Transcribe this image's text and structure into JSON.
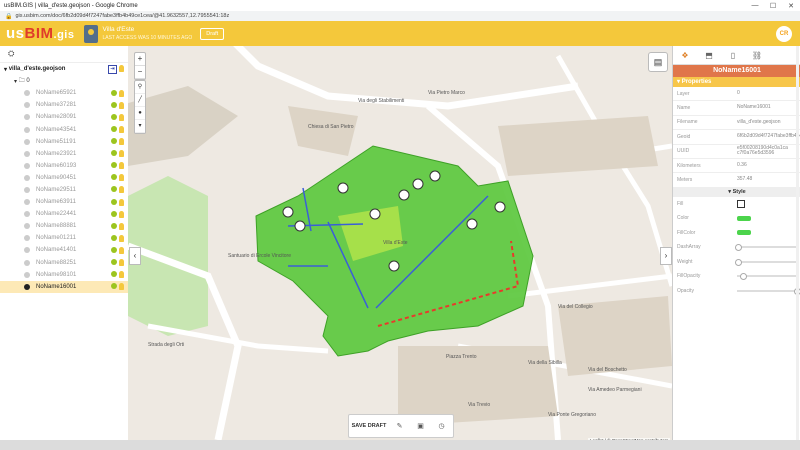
{
  "window": {
    "title": "usBIM.GIS | villa_d'este.geojson - Google Chrome",
    "controls": [
      "—",
      "☐",
      "✕"
    ]
  },
  "browser": {
    "url": "gis.usbim.com/doc/6fb2d09d4f7247fabe3ffb4b49ce1cea/@41.9632557,12.7955541:18z"
  },
  "header": {
    "logo_a": "us",
    "logo_b": "BIM",
    "logo_c": ".gis",
    "project_name": "Villa d'Este",
    "project_sub": "LAST ACCESS WAS 10 MINUTES AGO",
    "draft": "Draft",
    "avatar": "CR"
  },
  "tree": {
    "root": "villa_d'este.geojson",
    "group": "0",
    "items": [
      "NoName65921",
      "NoName37281",
      "NoName28091",
      "NoName43541",
      "NoName51191",
      "NoName23921",
      "NoName60193",
      "NoName90451",
      "NoName29511",
      "NoName63911",
      "NoName22441",
      "NoName88881",
      "NoName01211",
      "NoName41401",
      "NoName88251",
      "NoName98101",
      "NoName16001"
    ],
    "selected": "NoName16001"
  },
  "map": {
    "zoom_in": "+",
    "zoom_out": "−",
    "labels": {
      "street1": "Via degli Stabilimenti",
      "street2": "Strada degli Orti",
      "villa": "Villa d'Este",
      "piazza": "Piazza Trento",
      "church1": "Chiesa di San Pietro",
      "church2": "Santuario di Ercole Vincitore",
      "via_collegio": "Via del Collegio",
      "via_sibilla": "Via della Sibilla",
      "via_boschetto": "Via del Boschetto",
      "via_pietro": "Via Pietro Marco",
      "via_trevio": "Via Trevio",
      "via_ponte": "Via Ponte Gregoriano",
      "via_amedeo": "Via Amedeo Parmegiani"
    },
    "attribution": "Leaflet | © OpenStreetMap contributors"
  },
  "bottombar": {
    "save": "SAVE DRAFT"
  },
  "panel": {
    "title": "NoName16001",
    "section": "Properties",
    "props": [
      {
        "k": "Layer",
        "v": "0"
      },
      {
        "k": "Name",
        "v": "NoName16001"
      },
      {
        "k": "Filename",
        "v": "villa_d'este.geojson"
      },
      {
        "k": "Geoid",
        "v": "6f6b2d09d4f7247fabe3ffb4b49ce1cea"
      },
      {
        "k": "UUID",
        "v": "e5f00208190d4c0a1ca c7f0a76e5d3596"
      },
      {
        "k": "Kilometers",
        "v": "0.36"
      },
      {
        "k": "Meters",
        "v": "357.48"
      }
    ],
    "style_header": "Style",
    "style": {
      "fill": "Fill",
      "color": "Color",
      "fillcolor": "FillColor",
      "dasharray": "DashArray",
      "weight": "Weight",
      "fillopacity": "FillOpacity",
      "opacity": "Opacity"
    },
    "colors": {
      "fill": "#4cd44c"
    },
    "levels": {
      "dasharray": 0.02,
      "weight": 0.02,
      "fillopacity": 0.1,
      "opacity": 1.0
    }
  }
}
